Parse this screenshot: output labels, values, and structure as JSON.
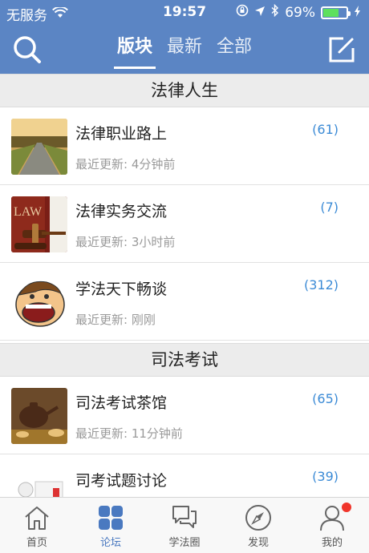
{
  "status_bar": {
    "carrier": "无服务",
    "time": "19:57",
    "battery": "69%",
    "battery_level": 0.69
  },
  "header": {
    "tabs": [
      {
        "label": "版块",
        "active": true
      },
      {
        "label": "最新",
        "active": false
      },
      {
        "label": "全部",
        "active": false
      }
    ]
  },
  "sections": [
    {
      "title": "法律人生",
      "forums": [
        {
          "title": "法律职业路上",
          "subtitle": "最近更新: 4分钟前",
          "count": "(61)"
        },
        {
          "title": "法律实务交流",
          "subtitle": "最近更新: 3小时前",
          "count": "(7)"
        },
        {
          "title": "学法天下畅谈",
          "subtitle": "最近更新: 刚刚",
          "count": "(312)"
        }
      ]
    },
    {
      "title": "司法考试",
      "forums": [
        {
          "title": "司法考试茶馆",
          "subtitle": "最近更新: 11分钟前",
          "count": "(65)"
        },
        {
          "title": "司考试题讨论",
          "subtitle": "",
          "count": "(39)"
        }
      ]
    }
  ],
  "tabbar": {
    "items": [
      {
        "label": "首页",
        "icon": "home-icon",
        "active": false
      },
      {
        "label": "论坛",
        "icon": "forum-grid-icon",
        "active": true
      },
      {
        "label": "学法圈",
        "icon": "chat-bubbles-icon",
        "active": false
      },
      {
        "label": "发现",
        "icon": "compass-icon",
        "active": false
      },
      {
        "label": "我的",
        "icon": "user-icon",
        "active": false,
        "badge": true
      }
    ]
  },
  "colors": {
    "header_blue": "#5b85c4",
    "count_blue": "#3c8bd6",
    "tab_active": "#4a79c0",
    "badge_red": "#f0352b"
  }
}
